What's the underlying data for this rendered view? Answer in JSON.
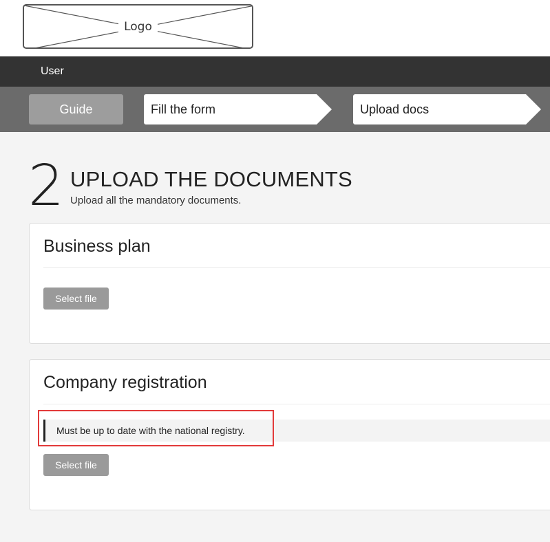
{
  "logo": {
    "text": "Logo"
  },
  "userbar": {
    "user_label": "User"
  },
  "steps": {
    "guide": "Guide",
    "fill_form": "Fill the form",
    "upload_docs": "Upload docs"
  },
  "page": {
    "step_number": "2",
    "title": "UPLOAD THE DOCUMENTS",
    "subtitle": "Upload all the mandatory documents."
  },
  "sections": [
    {
      "title": "Business plan",
      "button_label": "Select file"
    },
    {
      "title": "Company registration",
      "note": "Must be up to date with the national registry.",
      "button_label": "Select file"
    }
  ],
  "colors": {
    "userbar_bg": "#333333",
    "stepsbar_bg": "#6b6b6b",
    "button_bg": "#9a9a9a",
    "highlight": "#e23a3a"
  }
}
